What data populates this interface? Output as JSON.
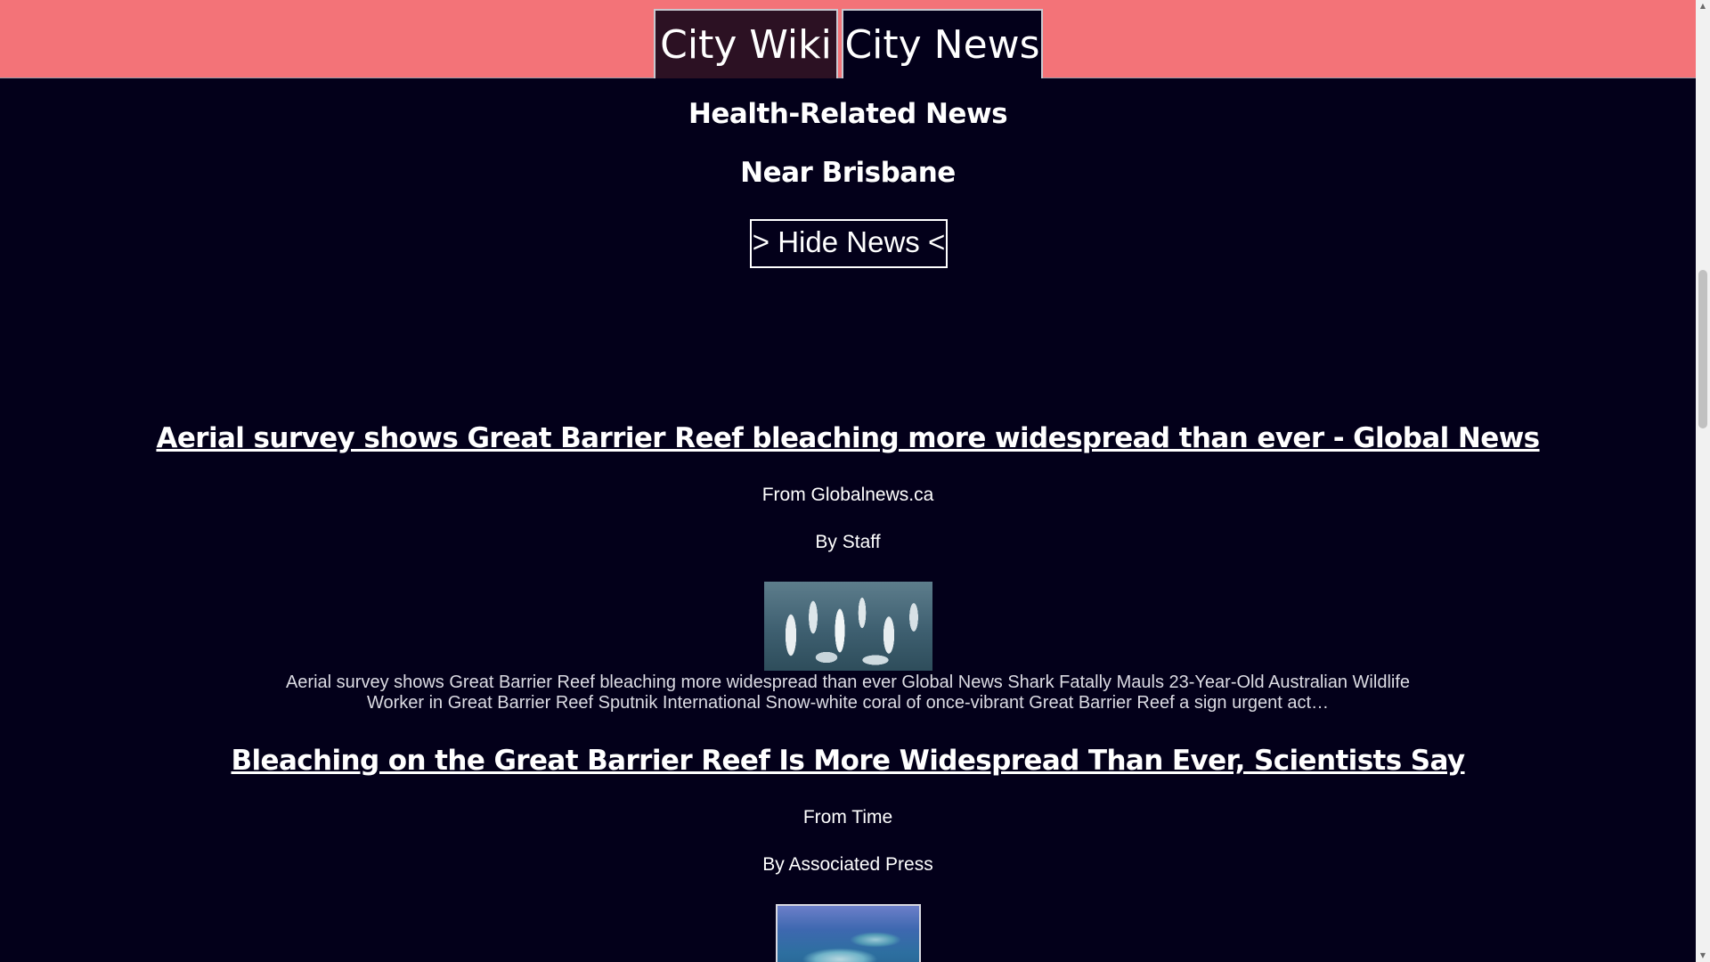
{
  "tabs": [
    {
      "label": "City Wiki",
      "active": false
    },
    {
      "label": "City News",
      "active": true
    }
  ],
  "colors": {
    "header_bg": "#f37378",
    "page_bg": "#03001a",
    "inactive_tab_bg": "#2c1123",
    "text": "#ffffff"
  },
  "headings": {
    "section": "Health-Related News",
    "location": "Near Brisbane"
  },
  "hide_button_label": "> Hide News <",
  "articles": [
    {
      "title": "Aerial survey shows Great Barrier Reef bleaching more widespread than ever - Global News",
      "source": "From Globalnews.ca",
      "author": "By Staff",
      "image": "bleached-coral-thumbnail",
      "description": "Aerial survey shows Great Barrier Reef bleaching more widespread than ever Global News Shark Fatally Mauls 23-Year-Old Australian Wildlife Worker in Great Barrier Reef Sputnik International Snow-white coral of once-vibrant Great Barrier Reef a sign urgent act…"
    },
    {
      "title": "Bleaching on the Great Barrier Reef Is More Widespread Than Ever, Scientists Say",
      "source": "From Time",
      "author": "By Associated Press",
      "image": "reef-aerial-thumbnail"
    }
  ],
  "icons": {
    "scroll_up": "scroll-up-arrow-icon",
    "scroll_down": "scroll-down-arrow-icon"
  }
}
